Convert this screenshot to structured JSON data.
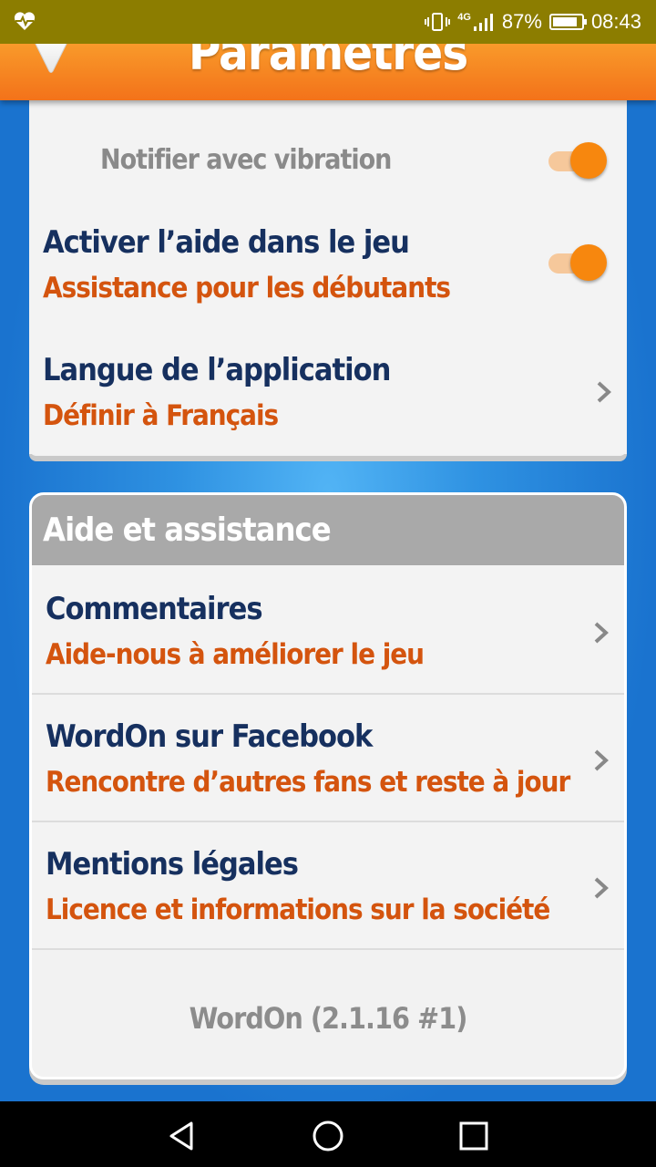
{
  "status_bar": {
    "network": "4G",
    "battery_percent": "87%",
    "battery_level": 0.87,
    "time": "08:43",
    "left_icon": "heart-monitor-icon"
  },
  "header": {
    "title": "Paramètres",
    "back_icon": "triangle-down-icon",
    "color": "#f57f1f"
  },
  "general": {
    "rows": [
      {
        "label": "Notifier avec vibration",
        "toggle_on": true
      },
      {
        "title": "Activer l’aide dans le jeu",
        "subtitle": "Assistance pour les débutants",
        "toggle_on": true
      },
      {
        "title": "Langue de l’application",
        "subtitle": "Définir à Français"
      }
    ]
  },
  "help": {
    "header": "Aide et assistance",
    "rows": [
      {
        "title": "Commentaires",
        "subtitle": "Aide-nous à améliorer le jeu"
      },
      {
        "title": "WordOn sur Facebook",
        "subtitle": "Rencontre d’autres fans et reste à jour"
      },
      {
        "title": "Mentions légales",
        "subtitle": "Licence et informations sur la société"
      }
    ],
    "version": "WordOn (2.1.16 #1)"
  },
  "colors": {
    "title_text": "#16305f",
    "subtitle_text": "#d4540e",
    "toggle_on": "#f7870e"
  }
}
